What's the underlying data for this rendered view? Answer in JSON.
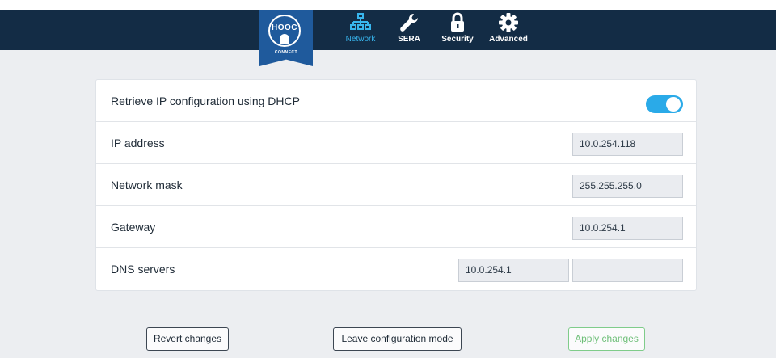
{
  "brand": {
    "logo_text": "HOOC",
    "logo_subtext": "CONNECT"
  },
  "nav": {
    "items": [
      {
        "label": "Network",
        "icon": "network-icon",
        "active": true
      },
      {
        "label": "SERA",
        "icon": "wrench-icon",
        "active": false
      },
      {
        "label": "Security",
        "icon": "lock-icon",
        "active": false
      },
      {
        "label": "Advanced",
        "icon": "gear-icon",
        "active": false
      }
    ]
  },
  "settings": {
    "dhcp": {
      "label": "Retrieve IP configuration using DHCP",
      "enabled": true
    },
    "ip_address": {
      "label": "IP address",
      "value": "10.0.254.118"
    },
    "network_mask": {
      "label": "Network mask",
      "value": "255.255.255.0"
    },
    "gateway": {
      "label": "Gateway",
      "value": "10.0.254.1"
    },
    "dns": {
      "label": "DNS servers",
      "primary": "10.0.254.1",
      "secondary": ""
    }
  },
  "actions": {
    "revert_label": "Revert changes",
    "leave_label": "Leave configuration mode",
    "apply_label": "Apply changes"
  },
  "colors": {
    "header": "#132c45",
    "accent": "#2aaae8",
    "logo": "#1f5a9c",
    "apply": "#6ebf78"
  }
}
